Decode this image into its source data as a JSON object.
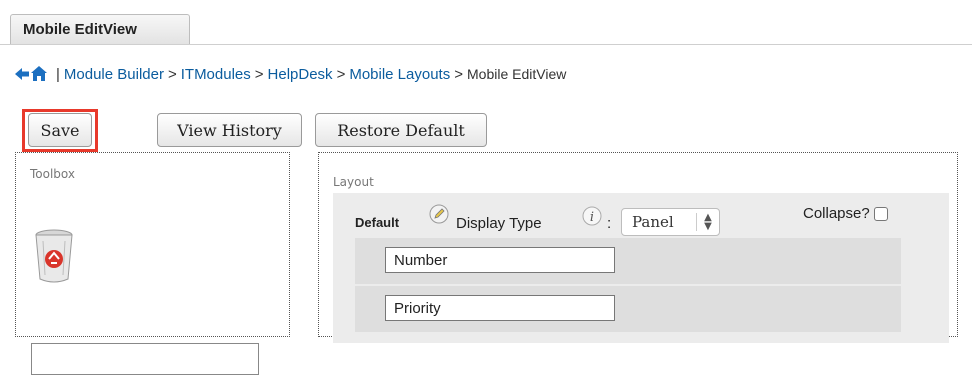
{
  "tab": {
    "label": "Mobile EditView"
  },
  "breadcrumb": {
    "items": [
      {
        "label": "Module Builder"
      },
      {
        "label": "ITModules"
      },
      {
        "label": "HelpDesk"
      },
      {
        "label": "Mobile Layouts"
      }
    ],
    "current": "Mobile EditView",
    "pipe": "|",
    "sep": ">"
  },
  "toolbar": {
    "save_label": "Save",
    "history_label": "View History",
    "restore_label": "Restore Default"
  },
  "toolbox": {
    "title": "Toolbox"
  },
  "layout": {
    "title": "Layout",
    "panel": {
      "name": "Default",
      "display_type_label": "Display Type",
      "colon": ":",
      "display_type_value": "Panel",
      "collapse_label": "Collapse?"
    },
    "fields": [
      "Number",
      "Priority"
    ]
  },
  "colors": {
    "link": "#0b5c9e",
    "highlight": "#e8392b"
  }
}
